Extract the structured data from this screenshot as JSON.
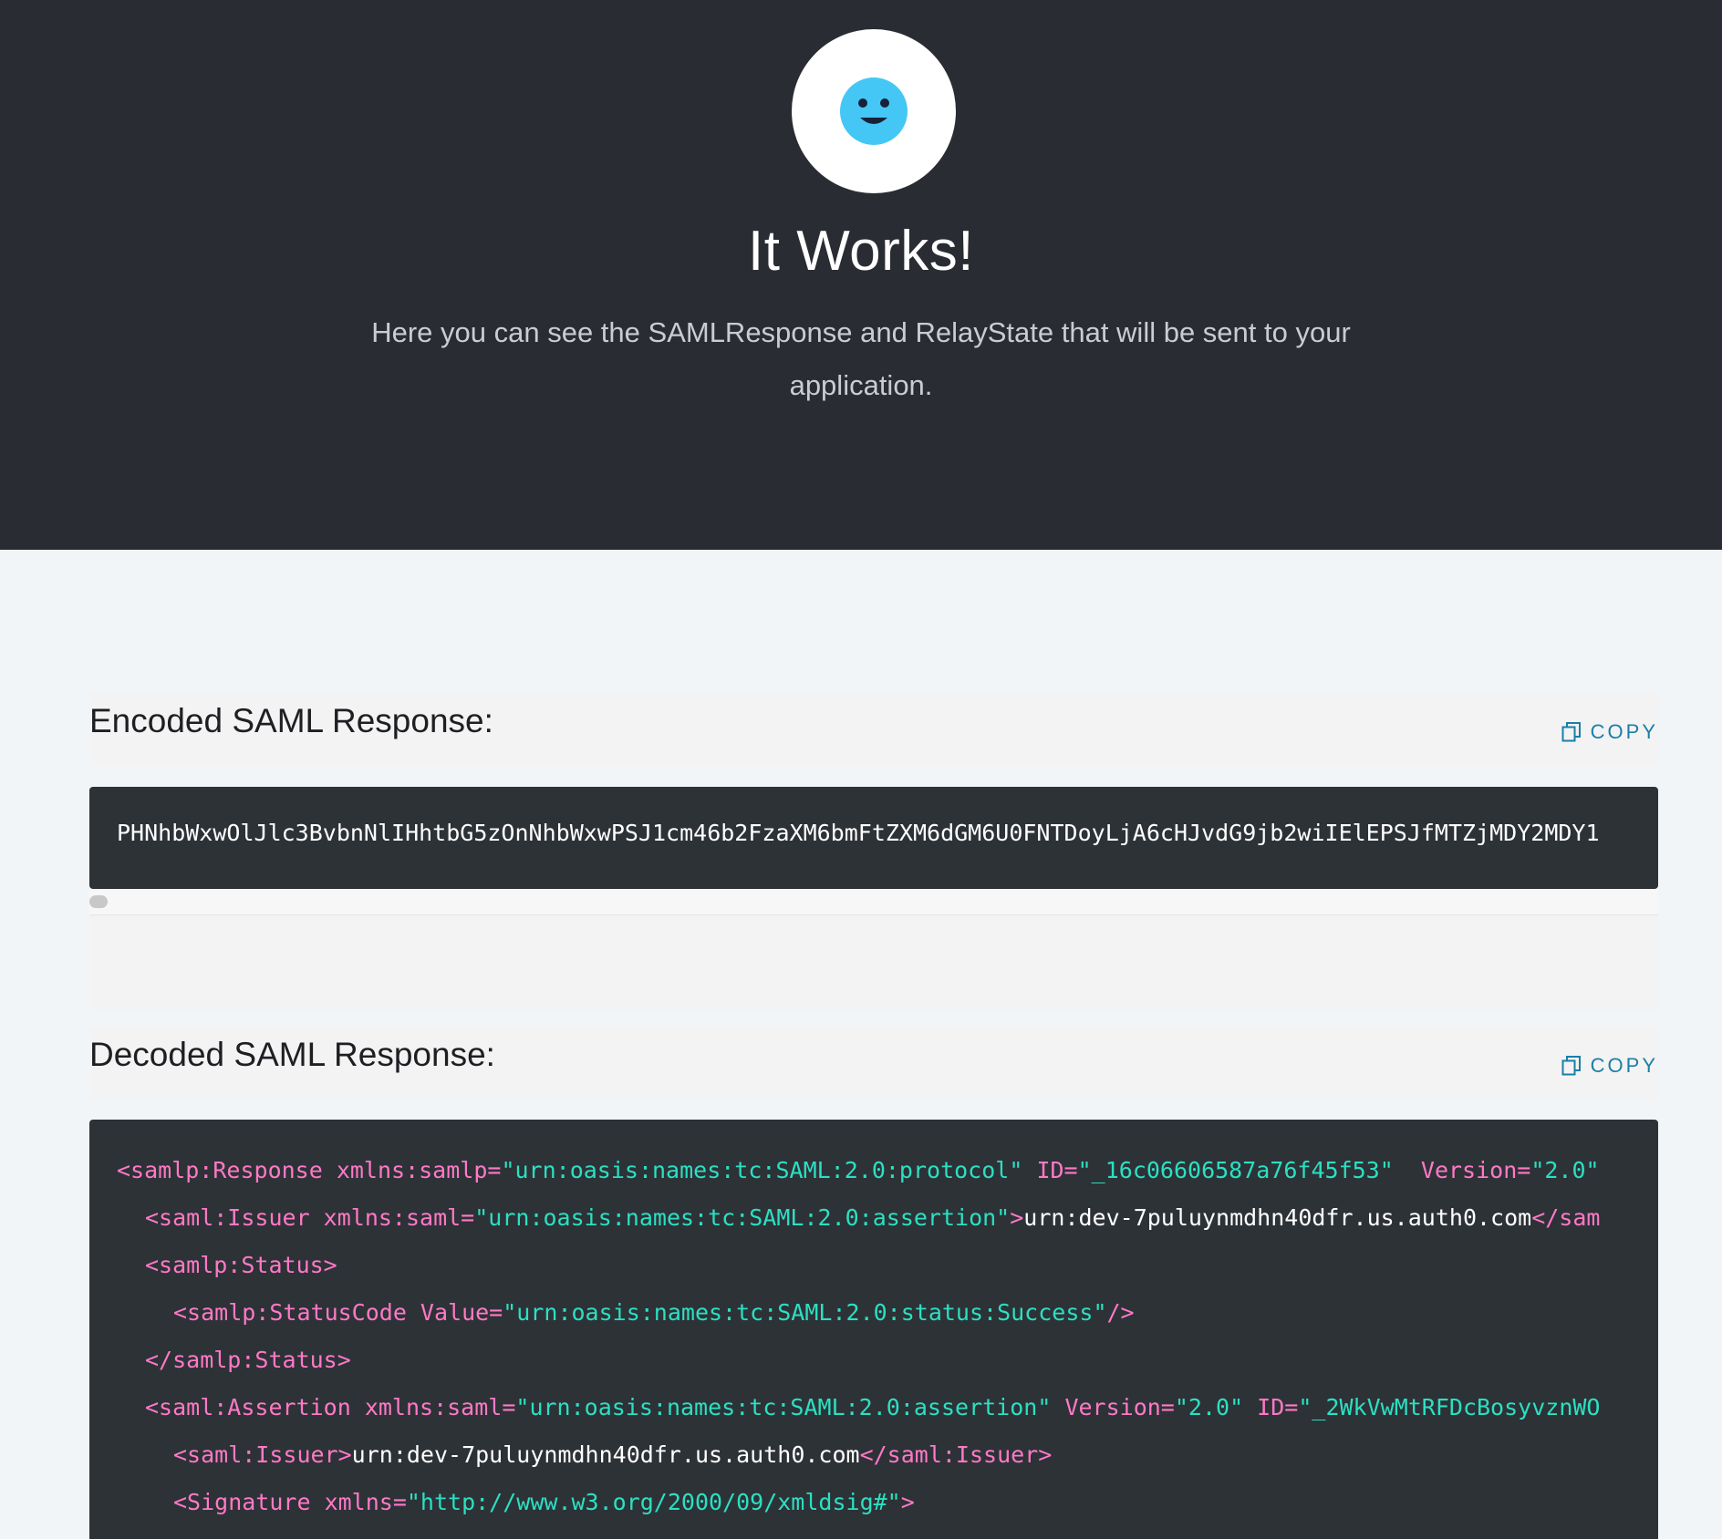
{
  "hero": {
    "icon": "smiley-face-icon",
    "title": "It Works!",
    "subtitle": "Here you can see the SAMLResponse and RelayState that will be sent to your application."
  },
  "colors": {
    "hero_bg": "#2a2c33",
    "page_bg": "#f2f5f8",
    "code_bg": "#2d3237",
    "accent": "#1a7fa8",
    "smiley": "#44c7f4",
    "xml_tag": "#ff79c6",
    "xml_string": "#2be0c2"
  },
  "encoded": {
    "title": "Encoded SAML Response:",
    "copy_label": "COPY",
    "value": "PHNhbWxwOlJlc3BvbnNlIHhtbG5zOnNhbWxwPSJ1cm46b2FzaXM6bmFtZXM6dGM6U0FNTDoyLjA6cHJvdG9jb2wiIElEPSJfMTZjMDY2MDY1"
  },
  "decoded": {
    "title": "Decoded SAML Response:",
    "copy_label": "COPY",
    "lines": [
      {
        "indent": 0,
        "parts": [
          {
            "c": "t",
            "text": "<samlp:Response xmlns:samlp="
          },
          {
            "c": "s",
            "text": "\"urn:oasis:names:tc:SAML:2.0:protocol\""
          },
          {
            "c": "t",
            "text": " ID="
          },
          {
            "c": "s",
            "text": "\"_16c06606587a76f45f53\""
          },
          {
            "c": "t",
            "text": "  Version="
          },
          {
            "c": "s",
            "text": "\"2.0\""
          }
        ]
      },
      {
        "indent": 1,
        "parts": [
          {
            "c": "t",
            "text": "<saml:Issuer xmlns:saml="
          },
          {
            "c": "s",
            "text": "\"urn:oasis:names:tc:SAML:2.0:assertion\""
          },
          {
            "c": "t",
            "text": ">"
          },
          {
            "c": "w",
            "text": "urn:dev-7puluynmdhn40dfr.us.auth0.com"
          },
          {
            "c": "t",
            "text": "</sam"
          }
        ]
      },
      {
        "indent": 1,
        "parts": [
          {
            "c": "t",
            "text": "<samlp:Status>"
          }
        ]
      },
      {
        "indent": 2,
        "parts": [
          {
            "c": "t",
            "text": "<samlp:StatusCode Value="
          },
          {
            "c": "s",
            "text": "\"urn:oasis:names:tc:SAML:2.0:status:Success\""
          },
          {
            "c": "t",
            "text": "/>"
          }
        ]
      },
      {
        "indent": 1,
        "parts": [
          {
            "c": "t",
            "text": "</samlp:Status>"
          }
        ]
      },
      {
        "indent": 1,
        "parts": [
          {
            "c": "t",
            "text": "<saml:Assertion xmlns:saml="
          },
          {
            "c": "s",
            "text": "\"urn:oasis:names:tc:SAML:2.0:assertion\""
          },
          {
            "c": "t",
            "text": " Version="
          },
          {
            "c": "s",
            "text": "\"2.0\""
          },
          {
            "c": "t",
            "text": " ID="
          },
          {
            "c": "s",
            "text": "\"_2WkVwMtRFDcBosyvznWO"
          }
        ]
      },
      {
        "indent": 2,
        "parts": [
          {
            "c": "t",
            "text": "<saml:Issuer>"
          },
          {
            "c": "w",
            "text": "urn:dev-7puluynmdhn40dfr.us.auth0.com"
          },
          {
            "c": "t",
            "text": "</saml:Issuer>"
          }
        ]
      },
      {
        "indent": 2,
        "parts": [
          {
            "c": "t",
            "text": "<Signature xmlns="
          },
          {
            "c": "s",
            "text": "\"http://www.w3.org/2000/09/xmldsig#\""
          },
          {
            "c": "t",
            "text": ">"
          }
        ]
      }
    ]
  }
}
